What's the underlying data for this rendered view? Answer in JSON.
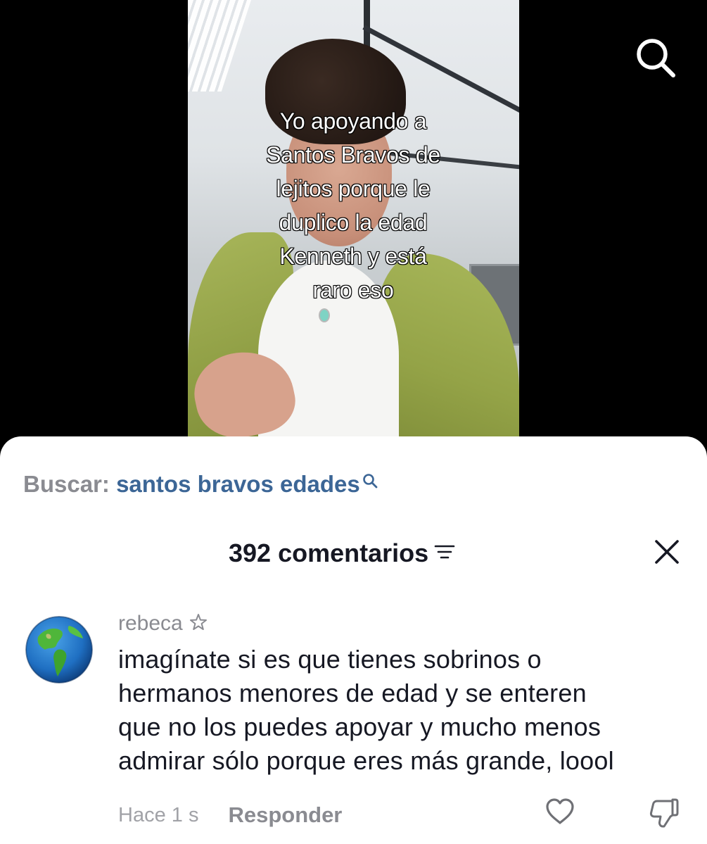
{
  "video": {
    "caption_lines": [
      "Yo apoyando a",
      "Santos Bravos de",
      "lejitos porque le",
      "duplico la edad",
      "Kenneth y está",
      "raro eso"
    ]
  },
  "top_bar": {
    "search_icon": "search-icon"
  },
  "search": {
    "prefix": "Buscar:",
    "query": "santos bravos edades",
    "icon": "search-icon",
    "query_color": "#3c6696"
  },
  "comments_header": {
    "count_label": "392 comentarios",
    "sort_icon": "sort-icon",
    "close_icon": "close-icon"
  },
  "comment": {
    "username": "rebeca",
    "badge_icon": "star-icon",
    "avatar": "globe-avatar",
    "text_lines": [
      "imagínate si es que tienes sobrinos o",
      "hermanos menores de edad y se enteren",
      "que no los puedes apoyar y mucho menos",
      "admirar sólo porque eres más grande, loool"
    ],
    "time": "Hace 1 s",
    "reply_label": "Responder",
    "like_icon": "heart-icon",
    "dislike_icon": "thumbs-down-icon"
  }
}
